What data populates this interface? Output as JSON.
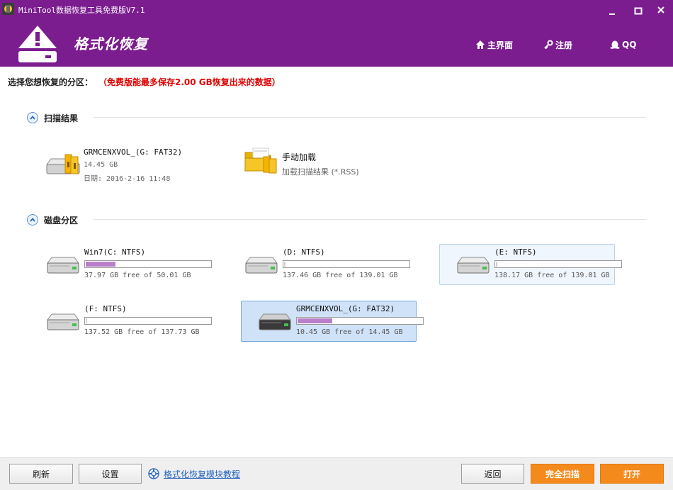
{
  "window": {
    "title": "MiniTool数据恢复工具免费版V7.1",
    "min_symbol": "▬",
    "max_symbol": "■",
    "close_symbol": "✕"
  },
  "header": {
    "title": "格式化恢复",
    "nav": {
      "home": "主界面",
      "register": "注册",
      "qq": "QQ"
    }
  },
  "instruction": {
    "label": "选择您想恢复的分区：",
    "free_note": "（免费版能最多保存2.00 GB恢复出来的数据）"
  },
  "scan_results": {
    "section_title": "扫描结果",
    "items": [
      {
        "title": "GRMCENXVOL_(G: FAT32)",
        "size": "14.45 GB",
        "date": "日期: 2016-2-16 11:48",
        "icon": "drive-icon"
      },
      {
        "title": "手动加载",
        "subtitle": "加载扫描结果 (*.RSS)",
        "icon": "folder-icon"
      }
    ]
  },
  "disk_partitions": {
    "section_title": "磁盘分区",
    "items": [
      {
        "name": "Win7(C: NTFS)",
        "usage": "37.97 GB free of 50.01 GB",
        "used_fraction": 0.24,
        "state": "normal"
      },
      {
        "name": "(D: NTFS)",
        "usage": "137.46 GB free of 139.01 GB",
        "used_fraction": 0.011,
        "state": "normal"
      },
      {
        "name": "(E: NTFS)",
        "usage": "138.17 GB free of 139.01 GB",
        "used_fraction": 0.006,
        "state": "hover"
      },
      {
        "name": "(F: NTFS)",
        "usage": "137.52 GB free of 137.73 GB",
        "used_fraction": 0.002,
        "state": "normal"
      },
      {
        "name": "GRMCENXVOL_(G: FAT32)",
        "usage": "10.45 GB free of 14.45 GB",
        "used_fraction": 0.28,
        "state": "selected"
      }
    ]
  },
  "footer": {
    "refresh": "刷新",
    "settings": "设置",
    "tutorial": "格式化恢复模块教程",
    "back": "返回",
    "full_scan": "完全扫描",
    "open": "打开"
  },
  "colors": {
    "header_bg": "#7b1c8f",
    "usage_fill": "#b97fc9",
    "warning": "#e00000",
    "action_orange": "#f58a1c",
    "link": "#1f5fbd"
  }
}
